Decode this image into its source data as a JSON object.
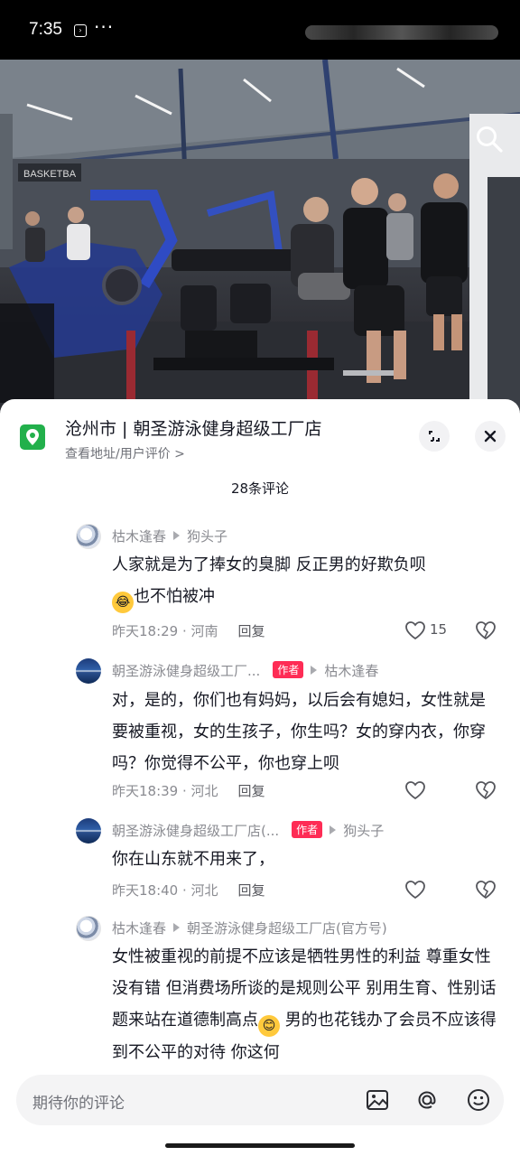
{
  "status_bar": {
    "time": "7:35",
    "dots": "···"
  },
  "poi": {
    "title": "沧州市 | 朝圣游泳健身超级工厂店",
    "subtitle": "查看地址/用户评价 >"
  },
  "comment_count": "28条评论",
  "comments": [
    {
      "author": "枯木逢春",
      "is_author": false,
      "reply_to": "狗头子",
      "text_1": "人家就是为了捧女的臭脚 反正男的好欺负呗",
      "text_2": "也不怕被冲",
      "emoji": "😂",
      "time": "昨天18:29 · 河南",
      "reply_label": "回复",
      "likes": "15"
    },
    {
      "author": "朝圣游泳健身超级工厂...",
      "is_author": true,
      "author_badge": "作者",
      "reply_to": "枯木逢春",
      "text": "对，是的，你们也有妈妈，以后会有媳妇，女性就是要被重视，女的生孩子，你生吗？女的穿内衣，你穿吗？你觉得不公平，你也穿上呗",
      "time": "昨天18:39 · 河北",
      "reply_label": "回复",
      "likes": ""
    },
    {
      "author": "朝圣游泳健身超级工厂店(...",
      "is_author": true,
      "author_badge": "作者",
      "reply_to": "狗头子",
      "text": "你在山东就不用来了，",
      "time": "昨天18:40 · 河北",
      "reply_label": "回复",
      "likes": ""
    },
    {
      "author": "枯木逢春",
      "is_author": false,
      "reply_to": "朝圣游泳健身超级工厂店(官方号)",
      "text_1": "女性被重视的前提不应该是牺牲男性的利益 尊重女性没有错 但消费场所谈的是规则公平 别用生育、性别话题来站在道德制高点",
      "emoji": "😊",
      "text_2": " 男的也花钱办了会员不应该得到不公平的对待 你这何"
    }
  ],
  "input": {
    "placeholder": "期待你的评论"
  },
  "icons": {
    "search": "search-icon",
    "expand": "expand-icon",
    "close": "close-icon",
    "location": "location-pin-icon",
    "like": "heart-icon",
    "dislike": "broken-heart-icon",
    "image": "image-icon",
    "mention": "at-icon",
    "emoji": "emoji-icon"
  },
  "colors": {
    "accent": "#fe2c55",
    "poi_green": "#22b04b"
  }
}
